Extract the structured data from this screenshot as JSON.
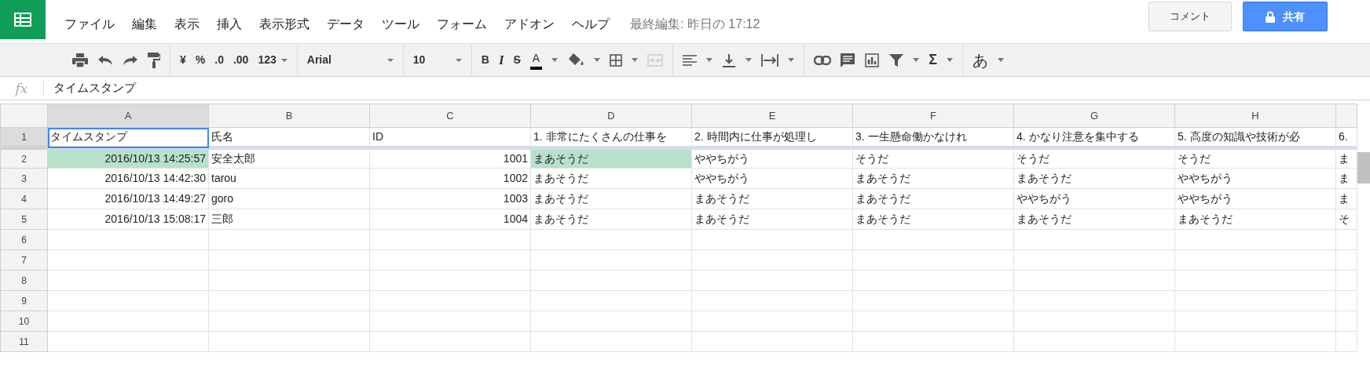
{
  "menu": [
    "ファイル",
    "編集",
    "表示",
    "挿入",
    "表示形式",
    "データ",
    "ツール",
    "フォーム",
    "アドオン",
    "ヘルプ"
  ],
  "last_edit": "最終編集: 昨日の 17:12",
  "comment_button": "コメント",
  "share_button": "共有",
  "toolbar": {
    "currency": "¥",
    "percent": "%",
    "decimal_less": ".0",
    "decimal_more": ".00",
    "number_format": "123",
    "font": "Arial",
    "font_size": "10",
    "bold": "B",
    "italic": "I",
    "strike": "S",
    "text_color": "A",
    "sum": "Σ",
    "input_tool": "あ"
  },
  "formula_bar": {
    "label": "fx",
    "content": "タイムスタンプ"
  },
  "columns": [
    {
      "letter": "A",
      "selected": true
    },
    {
      "letter": "B",
      "selected": false
    },
    {
      "letter": "C",
      "selected": false
    },
    {
      "letter": "D",
      "selected": false
    },
    {
      "letter": "E",
      "selected": false
    },
    {
      "letter": "F",
      "selected": false
    },
    {
      "letter": "G",
      "selected": false
    },
    {
      "letter": "H",
      "selected": false
    }
  ],
  "rows": [
    {
      "number": "1",
      "selected": true,
      "cells": [
        {
          "text": "タイムスタンプ",
          "kind": "text",
          "selected": true,
          "highlighted": false
        },
        {
          "text": "氏名",
          "kind": "text",
          "selected": false,
          "highlighted": false
        },
        {
          "text": "ID",
          "kind": "text",
          "selected": false,
          "highlighted": false
        },
        {
          "text": "1. 非常にたくさんの仕事を",
          "kind": "text",
          "selected": false,
          "highlighted": false
        },
        {
          "text": "2. 時間内に仕事が処理し",
          "kind": "text",
          "selected": false,
          "highlighted": false
        },
        {
          "text": "3. 一生懸命働かなけれ",
          "kind": "text",
          "selected": false,
          "highlighted": false
        },
        {
          "text": "4. かなり注意を集中する",
          "kind": "text",
          "selected": false,
          "highlighted": false
        },
        {
          "text": "5. 高度の知識や技術が必",
          "kind": "text",
          "selected": false,
          "highlighted": false
        },
        {
          "text": "6.",
          "kind": "text",
          "selected": false,
          "highlighted": false
        }
      ]
    },
    {
      "number": "2",
      "selected": false,
      "cells": [
        {
          "text": "2016/10/13 14:25:57",
          "kind": "number",
          "selected": false,
          "highlighted": true
        },
        {
          "text": "安全太郎",
          "kind": "text",
          "selected": false,
          "highlighted": false
        },
        {
          "text": "1001",
          "kind": "number",
          "selected": false,
          "highlighted": false
        },
        {
          "text": "まあそうだ",
          "kind": "text",
          "selected": false,
          "highlighted": true
        },
        {
          "text": "ややちがう",
          "kind": "text",
          "selected": false,
          "highlighted": false
        },
        {
          "text": "そうだ",
          "kind": "text",
          "selected": false,
          "highlighted": false
        },
        {
          "text": "そうだ",
          "kind": "text",
          "selected": false,
          "highlighted": false
        },
        {
          "text": "そうだ",
          "kind": "text",
          "selected": false,
          "highlighted": false
        },
        {
          "text": "ま",
          "kind": "text",
          "selected": false,
          "highlighted": false
        }
      ]
    },
    {
      "number": "3",
      "selected": false,
      "cells": [
        {
          "text": "2016/10/13 14:42:30",
          "kind": "number",
          "selected": false,
          "highlighted": false
        },
        {
          "text": "tarou",
          "kind": "text",
          "selected": false,
          "highlighted": false
        },
        {
          "text": "1002",
          "kind": "number",
          "selected": false,
          "highlighted": false
        },
        {
          "text": "まあそうだ",
          "kind": "text",
          "selected": false,
          "highlighted": false
        },
        {
          "text": "ややちがう",
          "kind": "text",
          "selected": false,
          "highlighted": false
        },
        {
          "text": "まあそうだ",
          "kind": "text",
          "selected": false,
          "highlighted": false
        },
        {
          "text": "まあそうだ",
          "kind": "text",
          "selected": false,
          "highlighted": false
        },
        {
          "text": "ややちがう",
          "kind": "text",
          "selected": false,
          "highlighted": false
        },
        {
          "text": "ま",
          "kind": "text",
          "selected": false,
          "highlighted": false
        }
      ]
    },
    {
      "number": "4",
      "selected": false,
      "cells": [
        {
          "text": "2016/10/13 14:49:27",
          "kind": "number",
          "selected": false,
          "highlighted": false
        },
        {
          "text": "goro",
          "kind": "text",
          "selected": false,
          "highlighted": false
        },
        {
          "text": "1003",
          "kind": "number",
          "selected": false,
          "highlighted": false
        },
        {
          "text": "まあそうだ",
          "kind": "text",
          "selected": false,
          "highlighted": false
        },
        {
          "text": "まあそうだ",
          "kind": "text",
          "selected": false,
          "highlighted": false
        },
        {
          "text": "まあそうだ",
          "kind": "text",
          "selected": false,
          "highlighted": false
        },
        {
          "text": "ややちがう",
          "kind": "text",
          "selected": false,
          "highlighted": false
        },
        {
          "text": "ややちがう",
          "kind": "text",
          "selected": false,
          "highlighted": false
        },
        {
          "text": "ま",
          "kind": "text",
          "selected": false,
          "highlighted": false
        }
      ]
    },
    {
      "number": "5",
      "selected": false,
      "cells": [
        {
          "text": "2016/10/13 15:08:17",
          "kind": "number",
          "selected": false,
          "highlighted": false
        },
        {
          "text": "三郎",
          "kind": "text",
          "selected": false,
          "highlighted": false
        },
        {
          "text": "1004",
          "kind": "number",
          "selected": false,
          "highlighted": false
        },
        {
          "text": "まあそうだ",
          "kind": "text",
          "selected": false,
          "highlighted": false
        },
        {
          "text": "まあそうだ",
          "kind": "text",
          "selected": false,
          "highlighted": false
        },
        {
          "text": "まあそうだ",
          "kind": "text",
          "selected": false,
          "highlighted": false
        },
        {
          "text": "まあそうだ",
          "kind": "text",
          "selected": false,
          "highlighted": false
        },
        {
          "text": "まあそうだ",
          "kind": "text",
          "selected": false,
          "highlighted": false
        },
        {
          "text": "そ",
          "kind": "text",
          "selected": false,
          "highlighted": false
        }
      ]
    },
    {
      "number": "6",
      "selected": false
    },
    {
      "number": "7",
      "selected": false
    },
    {
      "number": "8",
      "selected": false
    },
    {
      "number": "9",
      "selected": false
    },
    {
      "number": "10",
      "selected": false
    },
    {
      "number": "11",
      "selected": false
    }
  ]
}
